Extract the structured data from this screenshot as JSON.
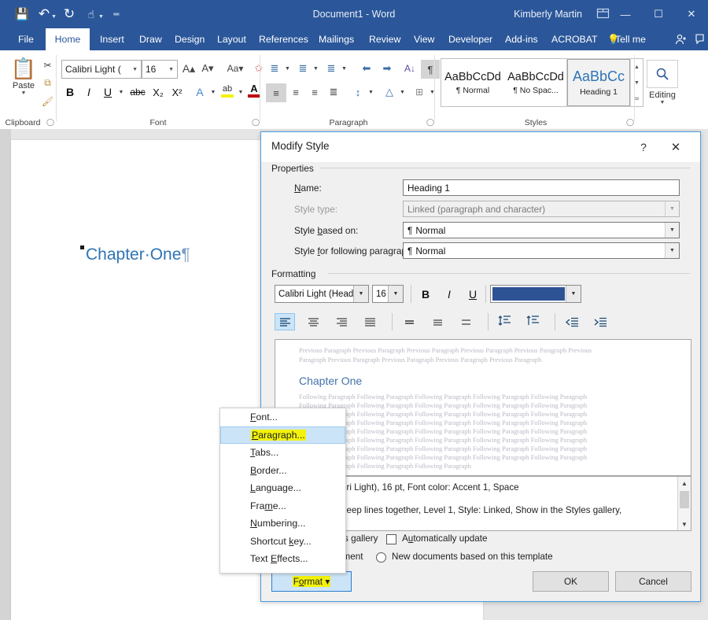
{
  "titlebar": {
    "quick_access": [
      {
        "name": "save-icon",
        "glyph": "💾"
      },
      {
        "name": "undo-icon",
        "glyph": "↶"
      },
      {
        "name": "redo-icon",
        "glyph": "↻"
      },
      {
        "name": "touch-mode-icon",
        "glyph": "☝"
      },
      {
        "name": "customize-qat-icon",
        "glyph": "═"
      }
    ],
    "document_title": "Document1  -  Word",
    "user_name": "Kimberly Martin",
    "ribbon_display_icon": "⬚",
    "minimize": "—",
    "maximize": "☐",
    "close": "✕",
    "background_color": "#2b579a"
  },
  "ribbon_tabs": [
    {
      "label": "File",
      "active": false
    },
    {
      "label": "Home",
      "active": true
    },
    {
      "label": "Insert",
      "active": false
    },
    {
      "label": "Draw",
      "active": false
    },
    {
      "label": "Design",
      "active": false
    },
    {
      "label": "Layout",
      "active": false
    },
    {
      "label": "References",
      "active": false
    },
    {
      "label": "Mailings",
      "active": false
    },
    {
      "label": "Review",
      "active": false
    },
    {
      "label": "View",
      "active": false
    },
    {
      "label": "Developer",
      "active": false
    },
    {
      "label": "Add-ins",
      "active": false
    },
    {
      "label": "ACROBAT",
      "active": false
    }
  ],
  "tell_me": "Tell me",
  "ribbon": {
    "clipboard": {
      "label": "Clipboard",
      "paste_label": "Paste",
      "cut_icon": "✂",
      "copy_icon": "⧉",
      "format_painter_icon": "🖌"
    },
    "font": {
      "label": "Font",
      "font_name": "Calibri Light (",
      "font_size": "16",
      "grow_font": "A",
      "shrink_font": "A",
      "change_case": "Aa",
      "clear_formatting": "A",
      "bold": "B",
      "italic": "I",
      "underline": "U",
      "strikethrough": "abc",
      "subscript": "X₂",
      "superscript": "X²",
      "text_effects": "A",
      "highlight": "ab",
      "font_color": "A"
    },
    "paragraph": {
      "label": "Paragraph",
      "bullets": "≣",
      "numbering": "≣",
      "multilevel": "≣",
      "decrease_indent": "⬅",
      "increase_indent": "➡",
      "sort": "A↓",
      "show_marks": "¶",
      "align_left": "≡",
      "center": "≡",
      "align_right": "≡",
      "justify": "≡",
      "line_spacing": "↕",
      "shading": "△",
      "borders": "⊞"
    },
    "styles": {
      "label": "Styles",
      "items": [
        {
          "preview": "AaBbCcDd",
          "name": "¶ Normal",
          "selected": false
        },
        {
          "preview": "AaBbCcDd",
          "name": "¶ No Spac...",
          "selected": false
        },
        {
          "preview": "AaBbCc",
          "name": "Heading 1",
          "selected": true
        }
      ]
    },
    "editing": {
      "label": "Editing",
      "icon": "🔍"
    }
  },
  "document": {
    "heading_text": "Chapter·One",
    "pilcrow": "¶",
    "heading_color": "#2e74b5"
  },
  "dialog": {
    "title": "Modify Style",
    "help_icon": "?",
    "close_icon": "✕",
    "properties": {
      "legend": "Properties",
      "name_label": "Name:",
      "name_value": "Heading 1",
      "style_type_label": "Style type:",
      "style_type_value": "Linked (paragraph and character)",
      "based_on_label": "Style based on:",
      "based_on_value": "Normal",
      "following_label": "Style for following paragraph:",
      "following_value": "Normal",
      "para_mark": "¶"
    },
    "formatting": {
      "legend": "Formatting",
      "font_name": "Calibri Light (Headin",
      "font_size": "16",
      "bold": "B",
      "italic": "I",
      "underline": "U",
      "font_color_hex": "#2e5395",
      "align_buttons": [
        {
          "name": "align-left",
          "glyph": "≡",
          "selected": true
        },
        {
          "name": "align-center",
          "glyph": "≡",
          "selected": false
        },
        {
          "name": "align-right",
          "glyph": "≡",
          "selected": false
        },
        {
          "name": "justify",
          "glyph": "≡",
          "selected": false
        }
      ],
      "spacing_buttons": [
        {
          "name": "line-spacing-single",
          "glyph": "═"
        },
        {
          "name": "line-spacing-1-5",
          "glyph": "≡"
        },
        {
          "name": "line-spacing-double",
          "glyph": "≡"
        }
      ],
      "paragraph_space_buttons": [
        {
          "name": "increase-paragraph-spacing",
          "glyph": "↕"
        },
        {
          "name": "decrease-paragraph-spacing",
          "glyph": "↕"
        }
      ],
      "indent_buttons": [
        {
          "name": "decrease-indent",
          "glyph": "⬅"
        },
        {
          "name": "increase-indent",
          "glyph": "➡"
        }
      ]
    },
    "preview": {
      "previous_line_1": "Previous Paragraph Previous Paragraph Previous Paragraph Previous Paragraph Previous Paragraph Previous",
      "previous_line_2": "Paragraph Previous Paragraph Previous Paragraph Previous Paragraph Previous Paragraph",
      "heading": "Chapter One",
      "following_line": "Following Paragraph Following Paragraph Following Paragraph Following Paragraph Following Paragraph",
      "following_last": "Following Paragraph Following Paragraph Following Paragraph"
    },
    "description": {
      "line1": "Headings (Calibri Light), 16 pt, Font color: Accent 1, Space",
      "line2": "eep with next, Keep lines together, Level 1, Style: Linked, Show in the Styles gallery,",
      "scroll_up": "⌃",
      "scroll_down": "⌄"
    },
    "options": {
      "add_to_gallery": "s gallery",
      "auto_update": "Automatically update",
      "only_this_document": "ument",
      "new_documents": "New documents based on this template"
    },
    "buttons": {
      "format": "Format",
      "format_caret": "▾",
      "ok": "OK",
      "cancel": "Cancel"
    }
  },
  "context_menu": {
    "items": [
      {
        "label": "Font...",
        "selected": false,
        "highlighted": false
      },
      {
        "label": "Paragraph...",
        "selected": true,
        "highlighted": true
      },
      {
        "label": "Tabs...",
        "selected": false,
        "highlighted": false
      },
      {
        "label": "Border...",
        "selected": false,
        "highlighted": false
      },
      {
        "label": "Language...",
        "selected": false,
        "highlighted": false
      },
      {
        "label": "Frame...",
        "selected": false,
        "highlighted": false
      },
      {
        "label": "Numbering...",
        "selected": false,
        "highlighted": false
      },
      {
        "label": "Shortcut key...",
        "selected": false,
        "highlighted": false
      },
      {
        "label": "Text Effects...",
        "selected": false,
        "highlighted": false
      }
    ]
  }
}
